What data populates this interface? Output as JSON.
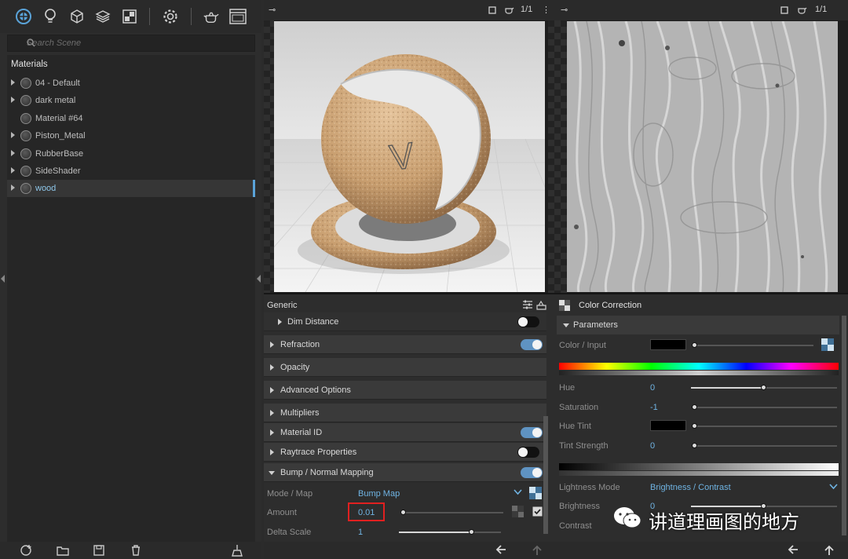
{
  "toolbar": {
    "icons": [
      "material-ball-icon",
      "light-bulb-icon",
      "cube-icon",
      "layers-icon",
      "texture-icon",
      "gear-icon",
      "teapot-icon",
      "window-icon"
    ]
  },
  "search": {
    "placeholder": "Search Scene"
  },
  "materials": {
    "title": "Materials",
    "items": [
      {
        "label": "04 - Default",
        "has_arrow": true
      },
      {
        "label": "dark metal",
        "has_arrow": true
      },
      {
        "label": "Material #64",
        "has_arrow": false
      },
      {
        "label": "Piston_Metal",
        "has_arrow": true
      },
      {
        "label": "RubberBase",
        "has_arrow": true
      },
      {
        "label": "SideShader",
        "has_arrow": true
      },
      {
        "label": "wood",
        "has_arrow": true,
        "selected": true
      }
    ]
  },
  "viewport_left": {
    "page_label": "1/1"
  },
  "viewport_right": {
    "page_label": "1/1"
  },
  "generic": {
    "title": "Generic",
    "groups": [
      {
        "label": "Dim Distance",
        "toggle": "off",
        "indent": true
      },
      {
        "label": "Refraction",
        "toggle": "on"
      },
      {
        "label": "Opacity"
      },
      {
        "label": "Advanced Options"
      },
      {
        "label": "Multipliers"
      },
      {
        "label": "Material ID",
        "toggle": "on"
      },
      {
        "label": "Raytrace Properties",
        "toggle": "off"
      },
      {
        "label": "Bump / Normal Mapping",
        "toggle": "on",
        "expanded": true
      }
    ],
    "mode_label": "Mode / Map",
    "mode_value": "Bump Map",
    "amount_label": "Amount",
    "amount_value": "0.01",
    "delta_label": "Delta Scale",
    "delta_value": "1"
  },
  "color_correction": {
    "title": "Color Correction",
    "parameters": "Parameters",
    "color_input_label": "Color / Input",
    "hue_label": "Hue",
    "hue_value": "0",
    "saturation_label": "Saturation",
    "saturation_value": "-1",
    "hue_tint_label": "Hue Tint",
    "tint_strength_label": "Tint Strength",
    "tint_strength_value": "0",
    "lightness_mode_label": "Lightness Mode",
    "lightness_mode_value": "Brightness / Contrast",
    "brightness_label": "Brightness",
    "brightness_value": "0",
    "contrast_label": "Contrast"
  },
  "watermark": "讲道理画图的地方",
  "colors": {
    "accent": "#5aa3d8",
    "value_text": "#6fb3e2",
    "highlight_box": "#e02020",
    "toggle_on": "#5f93c2"
  }
}
